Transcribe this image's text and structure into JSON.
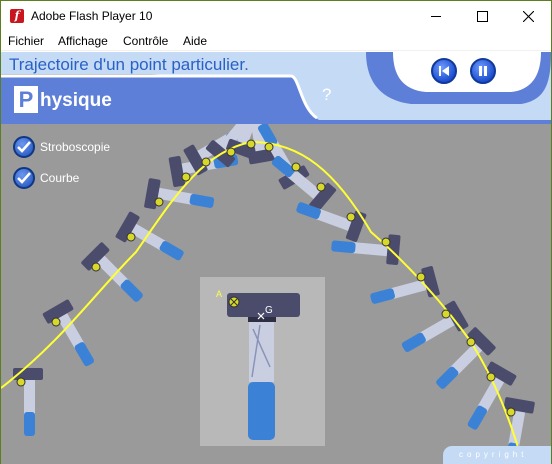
{
  "window": {
    "title": "Adobe Flash Player 10",
    "app_icon_glyph": "f"
  },
  "menu": {
    "items": [
      "Fichier",
      "Affichage",
      "Contrôle",
      "Aide"
    ]
  },
  "header": {
    "subtitle": "Trajectoire d'un point particulier.",
    "logo_initial": "P",
    "logo_rest": "hysique",
    "help": "?"
  },
  "options": [
    {
      "label": "Stroboscopie",
      "checked": true
    },
    {
      "label": "Courbe",
      "checked": true
    }
  ],
  "inset": {
    "point_a": "A",
    "point_g": "G"
  },
  "footer": {
    "copyright": "copyright"
  },
  "colors": {
    "stage_bg": "#9a9a9a",
    "band": "#c4daf5",
    "accent_blue": "#2a61c6",
    "trajectory": "#ffff33",
    "handle_blue": "#3b82d6",
    "hammer_head": "#4b4c6c"
  }
}
